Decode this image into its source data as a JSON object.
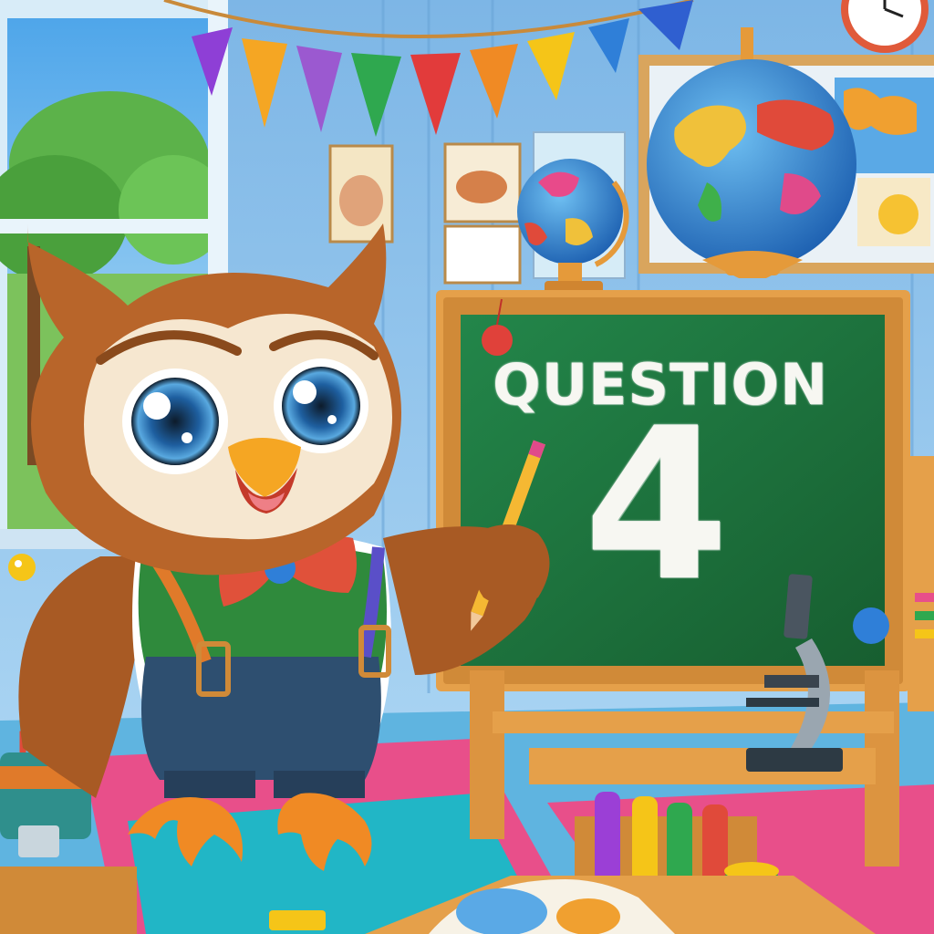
{
  "scene": {
    "description_free": true
  },
  "chalkboard": {
    "heading": "QUESTION",
    "number": "4"
  },
  "icons": {
    "owl": "owl-teacher-icon",
    "globe": "globe-icon",
    "microscope": "microscope-icon",
    "clock": "clock-icon",
    "window": "window-icon",
    "bunting": "bunting-icon"
  },
  "colors": {
    "board_green": "#1f7a3a",
    "frame_wood": "#d9923a",
    "wall_blue": "#8fc3ea",
    "owl_brown": "#b8652a",
    "owl_cream": "#f6e7d0",
    "vest_green": "#2f8a3c"
  }
}
